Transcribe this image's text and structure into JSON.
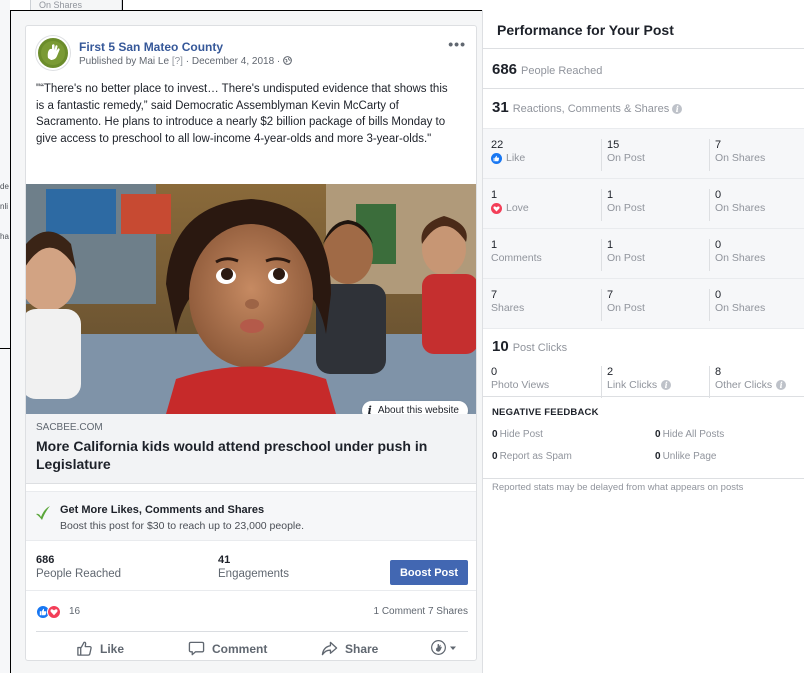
{
  "background": {
    "top_tab": "On Shares",
    "left_fragments": [
      "de",
      "nli",
      "ha"
    ]
  },
  "post": {
    "page_name": "First 5 San Mateo County",
    "published_by": "Published by Mai Le",
    "published_help": "[?]",
    "published_date": "· December 4, 2018 ·",
    "more_label": "•••",
    "text": "\"“There's no better place to invest… There's undisputed evidence that shows this is a fantastic remedy,” said Democratic Assemblyman Kevin McCarty of Sacramento. He plans to introduce a nearly $2 billion package of bills Monday to give access to preschool to all low-income 4-year-olds and more 3-year-olds.\"",
    "about_website": "About this website",
    "link_domain": "SACBEE.COM",
    "link_title": "More California kids would attend preschool under push in Legislature"
  },
  "boost_promo": {
    "title": "Get More Likes, Comments and Shares",
    "subtitle": "Boost this post for $30 to reach up to 23,000 people."
  },
  "summary_stats": {
    "reached_value": "686",
    "reached_label": "People Reached",
    "engagements_value": "41",
    "engagements_label": "Engagements",
    "boost_button": "Boost Post"
  },
  "reactions": {
    "count": "16",
    "comments": "1 Comment",
    "shares": "7 Shares"
  },
  "actions": {
    "like": "Like",
    "comment": "Comment",
    "share": "Share"
  },
  "performance": {
    "title": "Performance for Your Post",
    "reached_value": "686",
    "reached_label": "People Reached",
    "rcs_value": "31",
    "rcs_label": "Reactions, Comments & Shares",
    "rows": [
      {
        "c1_value": "22",
        "c1_label": "Like",
        "c2_value": "15",
        "c2_label": "On Post",
        "c3_value": "7",
        "c3_label": "On Shares"
      },
      {
        "c1_value": "1",
        "c1_label": "Love",
        "c2_value": "1",
        "c2_label": "On Post",
        "c3_value": "0",
        "c3_label": "On Shares"
      },
      {
        "c1_value": "1",
        "c1_label": "Comments",
        "c2_value": "1",
        "c2_label": "On Post",
        "c3_value": "0",
        "c3_label": "On Shares"
      },
      {
        "c1_value": "7",
        "c1_label": "Shares",
        "c2_value": "7",
        "c2_label": "On Post",
        "c3_value": "0",
        "c3_label": "On Shares"
      }
    ],
    "clicks_value": "10",
    "clicks_label": "Post Clicks",
    "clicks": {
      "photo_value": "0",
      "photo_label": "Photo Views",
      "link_value": "2",
      "link_label": "Link Clicks",
      "other_value": "8",
      "other_label": "Other Clicks"
    },
    "negative_title": "NEGATIVE FEEDBACK",
    "negative": {
      "hide_post_value": "0",
      "hide_post_label": "Hide Post",
      "hide_all_value": "0",
      "hide_all_label": "Hide All Posts",
      "spam_value": "0",
      "spam_label": "Report as Spam",
      "unlike_value": "0",
      "unlike_label": "Unlike Page"
    },
    "footnote": "Reported stats may be delayed from what appears on posts"
  },
  "colors": {
    "link_blue": "#365899",
    "button_blue": "#4267b2",
    "like_blue": "#1877f2",
    "love_red": "#f33e58",
    "check_green": "#42b72a"
  },
  "icons": [
    "globe-icon",
    "info-icon",
    "check-icon",
    "like-reaction-icon",
    "love-reaction-icon",
    "thumbs-up-icon",
    "comment-icon",
    "share-icon",
    "page-avatar-icon",
    "dropdown-caret-icon"
  ]
}
